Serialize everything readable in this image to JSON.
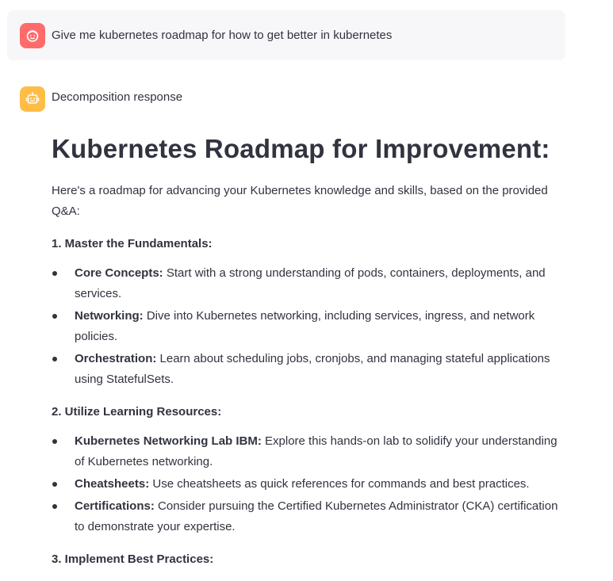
{
  "user_message": {
    "avatar_icon": "face-icon",
    "avatar_color": "#ff6b6b",
    "text": "Give me kubernetes roadmap for how to get better in kubernetes"
  },
  "assistant": {
    "avatar_icon": "robot-icon",
    "avatar_color": "#ffbd45",
    "label": "Decomposition response",
    "heading": "Kubernetes Roadmap for Improvement:",
    "intro": "Here's a roadmap for advancing your Kubernetes knowledge and skills, based on the provided Q&A:",
    "sections": [
      {
        "title": "1. Master the Fundamentals:",
        "items": [
          {
            "term": "Core Concepts:",
            "text": " Start with a strong understanding of pods, containers, deployments, and services."
          },
          {
            "term": "Networking:",
            "text": " Dive into Kubernetes networking, including services, ingress, and network policies."
          },
          {
            "term": "Orchestration:",
            "text": " Learn about scheduling jobs, cronjobs, and managing stateful applications using StatefulSets."
          }
        ]
      },
      {
        "title": "2. Utilize Learning Resources:",
        "items": [
          {
            "term": "Kubernetes Networking Lab IBM:",
            "text": " Explore this hands-on lab to solidify your understanding of Kubernetes networking."
          },
          {
            "term": "Cheatsheets:",
            "text": " Use cheatsheets as quick references for commands and best practices."
          },
          {
            "term": "Certifications:",
            "text": " Consider pursuing the Certified Kubernetes Administrator (CKA) certification to demonstrate your expertise."
          }
        ]
      },
      {
        "title": "3. Implement Best Practices:",
        "items": []
      }
    ]
  }
}
